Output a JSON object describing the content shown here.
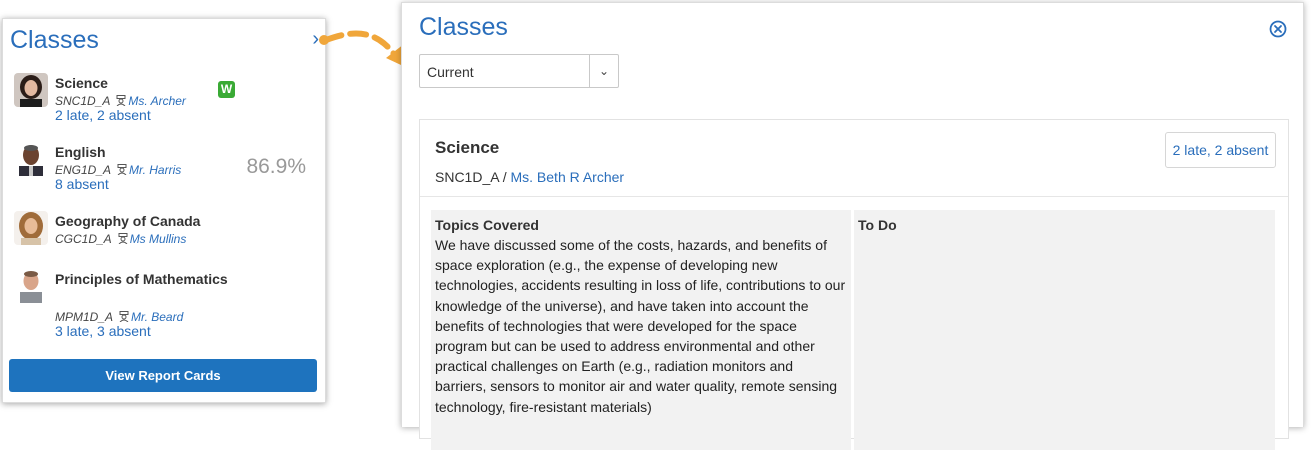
{
  "sidebar": {
    "title": "Classes",
    "chevron_icon": "chevron-right-icon",
    "classes": [
      {
        "name": "Science",
        "code": "SNC1D_A",
        "teacher": "Ms. Archer",
        "attendance": "2 late, 2 absent",
        "badge": "W",
        "grade": ""
      },
      {
        "name": "English",
        "code": "ENG1D_A",
        "teacher": "Mr. Harris",
        "attendance": "8 absent",
        "badge": "",
        "grade": "86.9%"
      },
      {
        "name": "Geography of Canada",
        "code": "CGC1D_A",
        "teacher": "Ms Mullins",
        "attendance": "",
        "badge": "",
        "grade": ""
      },
      {
        "name": "Principles of Mathematics",
        "code": "MPM1D_A",
        "teacher": "Mr. Beard",
        "attendance": "3 late, 3 absent",
        "badge": "",
        "grade": ""
      }
    ],
    "report_button": "View Report Cards"
  },
  "panel": {
    "title": "Classes",
    "close_icon": "close-circle-icon",
    "select": {
      "value": "Current"
    },
    "class": {
      "name": "Science",
      "code": "SNC1D_A",
      "separator": "/",
      "teacher": "Ms. Beth R Archer",
      "attendance": "2 late, 2 absent",
      "topics_label": "Topics Covered",
      "topics_text": "We have discussed some of the costs, hazards, and benefits of space exploration (e.g., the expense of developing new technologies, accidents resulting in loss of life, contributions to our knowledge of the universe), and have taken into account the benefits of technologies that were developed for the space program but can be used to address environmental and other practical challenges on Earth (e.g., radiation monitors and barriers, sensors to monitor air and water quality, remote sensing technology, fire-resistant materials)",
      "todo_label": "To Do"
    }
  },
  "colors": {
    "link": "#2a6ebb",
    "button": "#1e73be",
    "badge": "#3aaa35",
    "arrow": "#f0a63a"
  }
}
